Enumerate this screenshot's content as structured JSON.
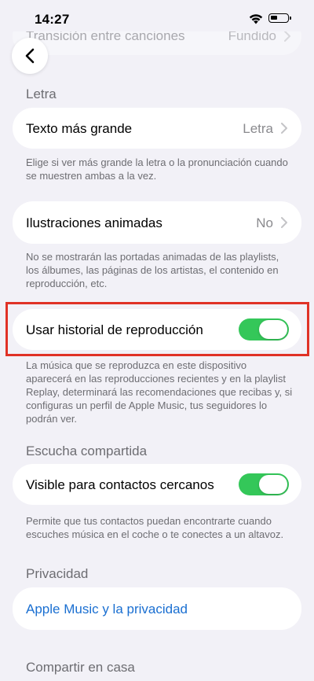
{
  "status_bar": {
    "time": "14:27"
  },
  "crossfade_row": {
    "label": "Transición entre canciones",
    "value": "Fundido"
  },
  "sections": {
    "lyrics_header": "Letra",
    "shared_listening_header": "Escucha compartida",
    "privacy_header": "Privacidad",
    "home_sharing_header": "Compartir en casa"
  },
  "larger_text": {
    "label": "Texto más grande",
    "value": "Letra",
    "footnote": "Elige si ver más grande la letra o la pronunciación cuando se muestren ambas a la vez."
  },
  "animated_art": {
    "label": "Ilustraciones animadas",
    "value": "No",
    "footnote": "No se mostrarán las portadas animadas de las playlists, los álbumes, las páginas de los artistas, el contenido en reproducción, etc."
  },
  "listening_history": {
    "label": "Usar historial de reproducción",
    "on": true,
    "footnote": "La música que se reproduzca en este dispositivo aparecerá en las reproducciones recientes y en la playlist Replay, determinará las recomendaciones que recibas y, si configuras un perfil de Apple Music, tus seguidores lo podrán ver."
  },
  "nearby_contacts": {
    "label": "Visible para contactos cercanos",
    "on": true,
    "footnote": "Permite que tus contactos puedan encontrarte cuando escuches música en el coche o te conectes a un altavoz."
  },
  "privacy_link": {
    "label": "Apple Music y la privacidad"
  },
  "colors": {
    "toggle_on": "#34c759",
    "link": "#1a6fd1",
    "highlight": "#e03226"
  },
  "icons": {
    "back": "chevron-left-icon",
    "disclosure": "chevron-right-icon",
    "wifi": "wifi-icon",
    "battery": "battery-icon"
  }
}
